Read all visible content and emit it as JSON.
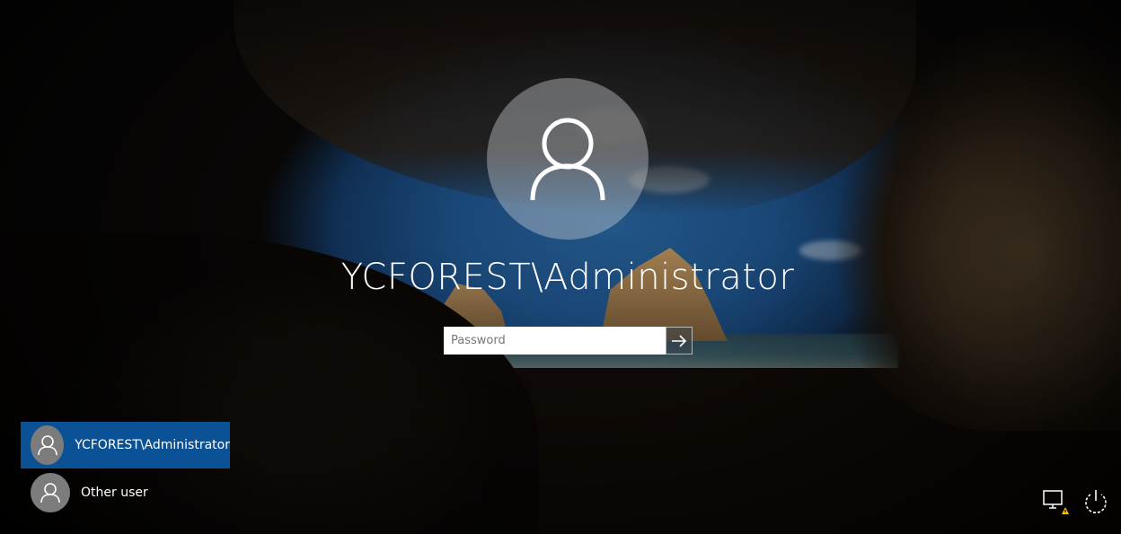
{
  "login": {
    "username": "YCFOREST\\Administrator",
    "password_placeholder": "Password",
    "password_value": ""
  },
  "users": [
    {
      "label": "YCFOREST\\Administrator",
      "selected": true
    },
    {
      "label": "Other user",
      "selected": false
    }
  ],
  "icons": {
    "avatar": "user-avatar-icon",
    "submit": "arrow-right-icon",
    "network": "network-warning-icon",
    "power": "power-icon"
  },
  "colors": {
    "selected_tile": "#0a5196",
    "avatar_circle": "#7c7c7c"
  }
}
